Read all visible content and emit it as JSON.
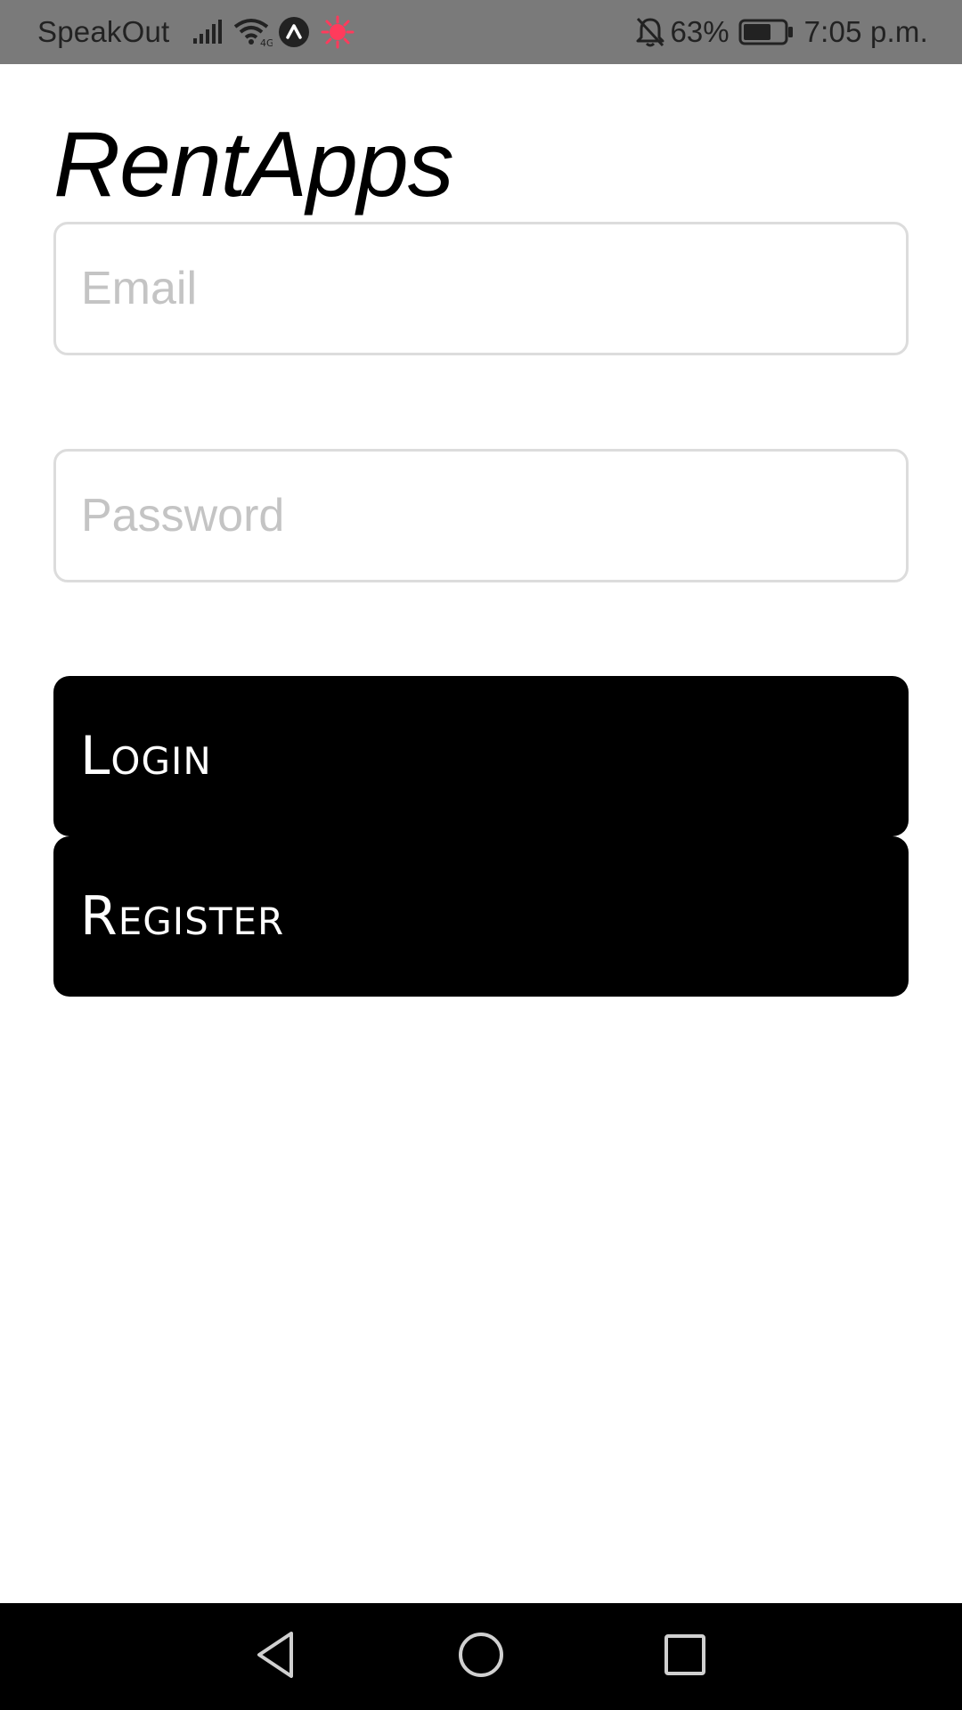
{
  "status_bar": {
    "carrier": "SpeakOut",
    "battery_percent": "63%",
    "time": "7:05 p.m.",
    "recording_color": "#ff3b5c"
  },
  "app": {
    "title": "RentApps"
  },
  "form": {
    "email_placeholder": "Email",
    "password_placeholder": "Password",
    "login_label": "Login",
    "register_label": "Register"
  },
  "navigation": {
    "items": [
      "back-icon",
      "home-icon",
      "recents-icon"
    ]
  }
}
